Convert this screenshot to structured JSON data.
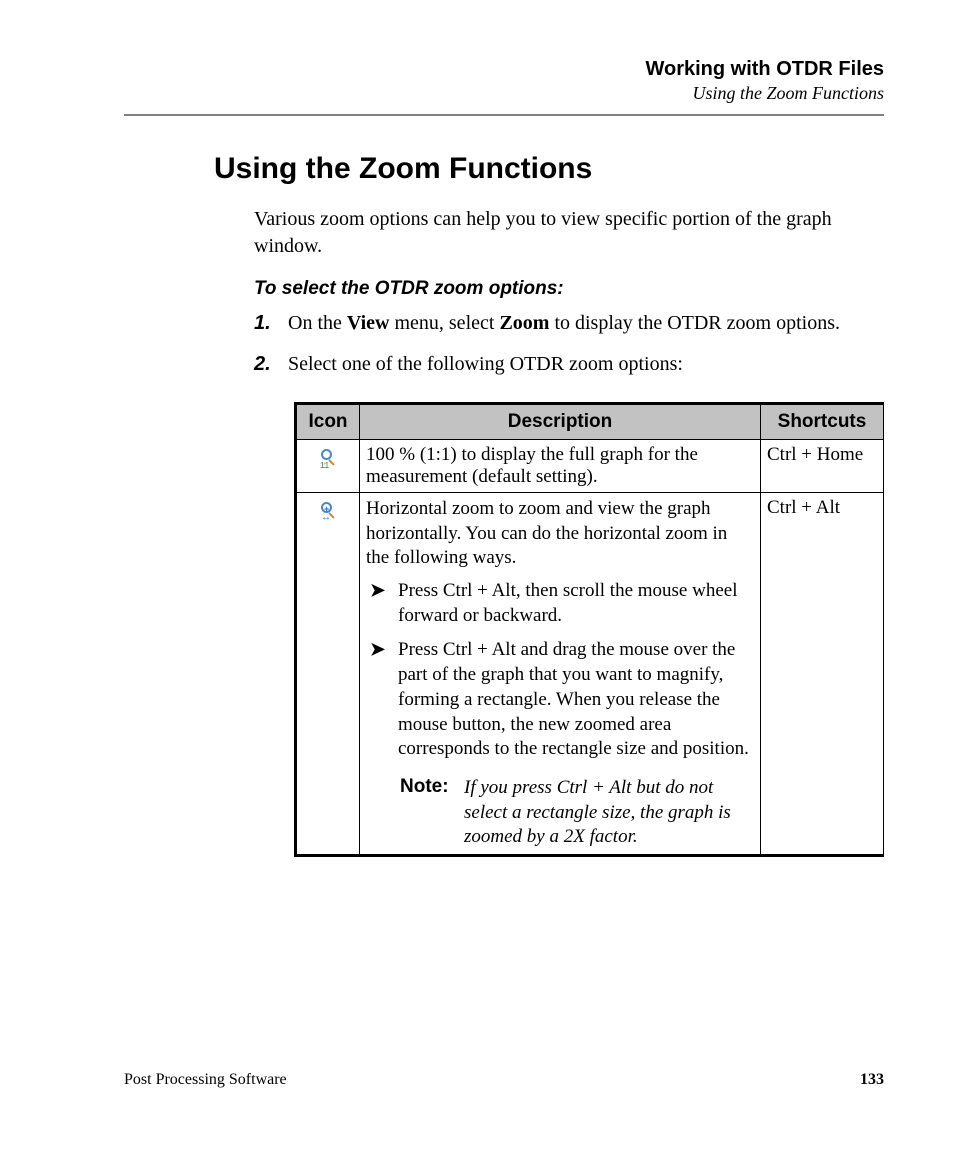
{
  "header": {
    "chapter": "Working with OTDR Files",
    "section_breadcrumb": "Using the Zoom Functions"
  },
  "title": "Using the Zoom Functions",
  "intro": "Various zoom options can help you to view specific portion of the graph window.",
  "procedure_label": "To select the OTDR zoom options:",
  "steps": [
    {
      "num": "1.",
      "pre": "On the ",
      "b1": "View",
      "mid": " menu, select ",
      "b2": "Zoom",
      "post": " to display the OTDR zoom options."
    },
    {
      "num": "2.",
      "text": "Select one of the following OTDR zoom options:"
    }
  ],
  "table": {
    "headers": {
      "icon": "Icon",
      "desc": "Description",
      "sc": "Shortcuts"
    },
    "rows": [
      {
        "icon": "zoom-100-icon",
        "desc_main": "100 % (1:1) to display the full graph for the measurement (default setting).",
        "shortcut": "Ctrl + Home"
      },
      {
        "icon": "zoom-horizontal-icon",
        "desc_main": "Horizontal zoom to zoom and view the graph horizontally. You can do the horizontal zoom in the following ways.",
        "bullets": [
          "Press Ctrl + Alt, then scroll the mouse wheel forward or backward.",
          "Press Ctrl + Alt and drag the mouse over the part of the graph that you want to magnify, forming a rectangle. When you release the mouse button, the new zoomed area corresponds to the rectangle size and position."
        ],
        "note_label": "Note:",
        "note_text": "If you press Ctrl + Alt but do not select a rectangle size, the graph is zoomed by a 2X factor.",
        "shortcut": "Ctrl + Alt"
      }
    ]
  },
  "footer": {
    "product": "Post Processing Software",
    "page": "133"
  },
  "glyphs": {
    "arrow": "➤"
  }
}
